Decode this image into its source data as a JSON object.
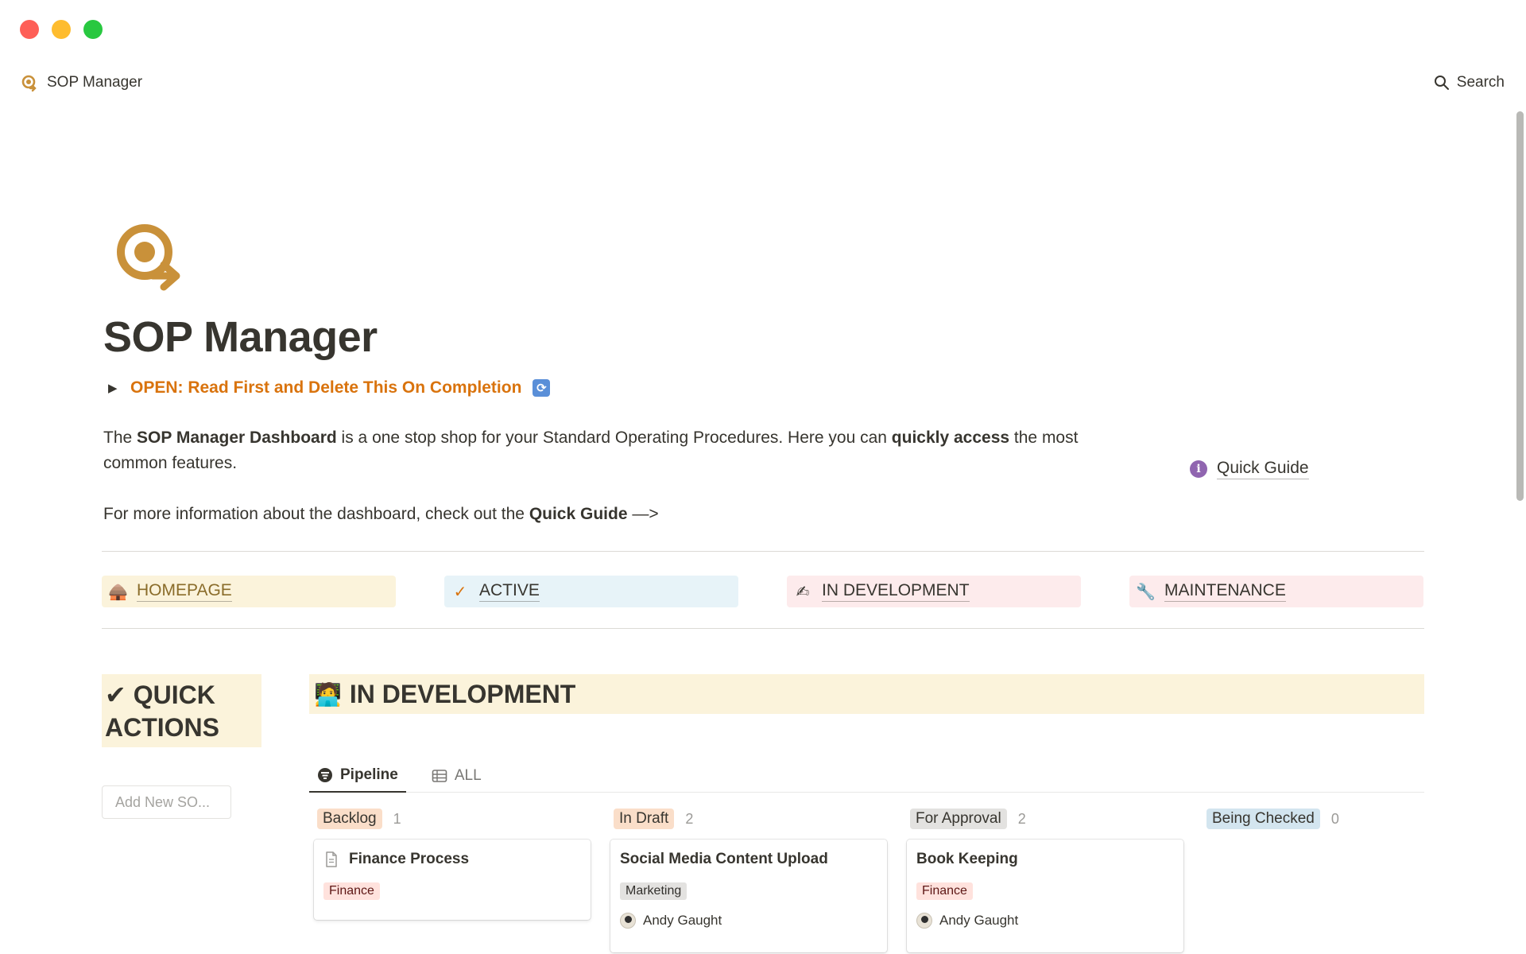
{
  "window": {
    "controls": [
      "close",
      "minimize",
      "maximize"
    ]
  },
  "topbar": {
    "breadcrumb": "SOP Manager",
    "search_label": "Search"
  },
  "page": {
    "title": "SOP Manager",
    "toggle_text": "OPEN: Read First and Delete This On Completion",
    "intro": {
      "p1_a": "The ",
      "p1_b": "SOP Manager Dashboard",
      "p1_c": " is a one stop shop for your Standard Operating Procedures. Here you can ",
      "p1_d": "quickly access",
      "p1_e": " the most common features.",
      "p2_a": "For more information about the dashboard, check out the ",
      "p2_b": "Quick Guide",
      "p2_c": " —>"
    },
    "quick_guide_label": "Quick Guide"
  },
  "nav": [
    {
      "label": "HOMEPAGE",
      "icon": "hut-emoji"
    },
    {
      "label": "ACTIVE",
      "icon": "checkmark"
    },
    {
      "label": "IN DEVELOPMENT",
      "icon": "writing-hand-emoji"
    },
    {
      "label": "MAINTENANCE",
      "icon": "wrench-emoji"
    }
  ],
  "quick_actions": {
    "title_line1": "QUICK",
    "title_line2": "ACTIONS",
    "add_button": "Add New SO..."
  },
  "in_development": {
    "heading": "IN DEVELOPMENT",
    "tabs": [
      {
        "label": "Pipeline",
        "active": true
      },
      {
        "label": "ALL",
        "active": false
      }
    ],
    "columns": [
      {
        "name": "Backlog",
        "count": "1",
        "color": "#fadec9",
        "cards": [
          {
            "title": "Finance Process",
            "tag": "Finance",
            "has_doc_icon": true
          }
        ]
      },
      {
        "name": "In Draft",
        "count": "2",
        "color": "#fadec9",
        "cards": [
          {
            "title": "Social Media Content Upload",
            "tag": "Marketing",
            "person": "Andy Gaught"
          }
        ]
      },
      {
        "name": "For Approval",
        "count": "2",
        "color": "#e3e2e0",
        "cards": [
          {
            "title": "Book Keeping",
            "tag": "Finance",
            "person": "Andy Gaught"
          }
        ]
      },
      {
        "name": "Being Checked",
        "count": "0",
        "color": "#d3e5ef",
        "cards": []
      }
    ]
  },
  "colors": {
    "accent_orange": "#d9730d",
    "brand_gold": "#c9913a",
    "yellow_block": "#fbf3db"
  }
}
